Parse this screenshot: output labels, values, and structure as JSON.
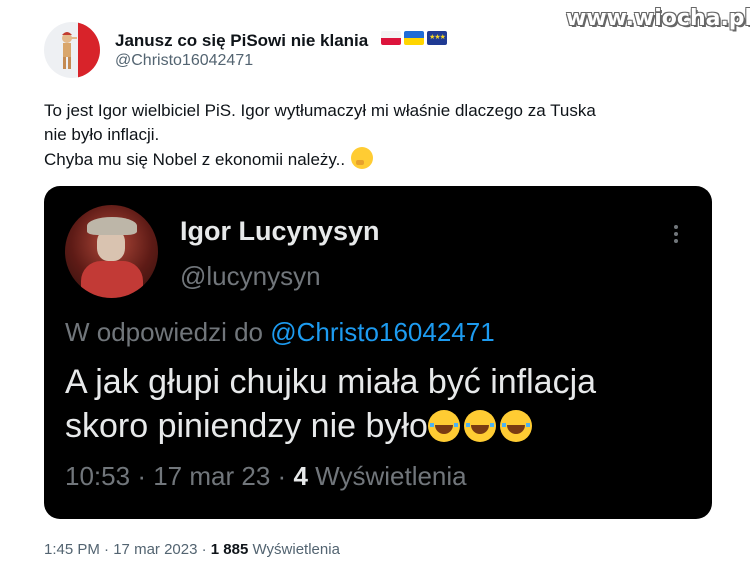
{
  "watermark": "www.wiocha.pl",
  "author": {
    "name": "Janusz co się PiSowi nie klania",
    "handle": "@Christo16042471",
    "flags": [
      "poland-flag",
      "ukraine-flag",
      "eu-flag"
    ]
  },
  "tweet": {
    "lines": [
      "To jest Igor wielbiciel PiS. Igor wytłumaczył mi właśnie dlaczego za Tuska",
      "nie było inflacji.",
      "Chyba mu się Nobel z ekonomii należy.."
    ],
    "emoji": "thinking-face"
  },
  "embedded": {
    "name": "Igor Lucynysyn",
    "handle": "@lucynysyn",
    "reply_prefix": "W odpowiedzi do",
    "reply_to": "@Christo16042471",
    "text_line1": "A jak głupi chujku miała być inflacja",
    "text_line2": "skoro piniendzy nie było",
    "emojis": [
      "laughing-face",
      "laughing-face",
      "laughing-face"
    ],
    "time": "10:53",
    "date": "17 mar 23",
    "views_count": "4",
    "views_label": "Wyświetlenia",
    "separator": "·"
  },
  "footer": {
    "time": "1:45 PM",
    "date": "17 mar 2023",
    "views_count": "1 885",
    "views_label": "Wyświetlenia",
    "separator": "·"
  }
}
